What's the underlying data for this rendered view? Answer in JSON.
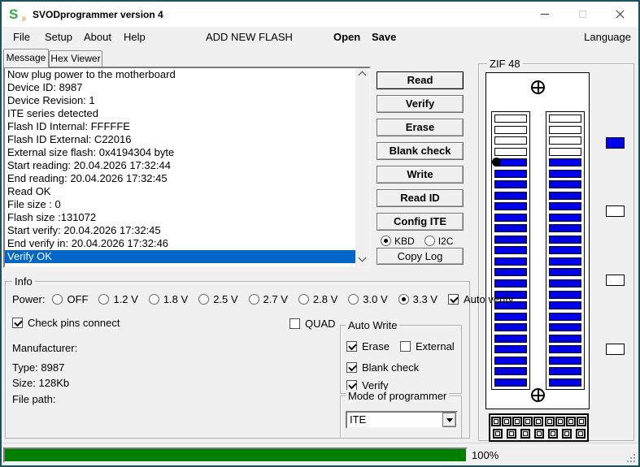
{
  "window": {
    "title": "SVODprogrammer version 4",
    "icon_text": "S",
    "icon_sub": "p"
  },
  "icons": {
    "app": "green-s-logo",
    "minimize": "minus-line",
    "maximize": "square-outline-disabled",
    "close": "x-cross",
    "scroll_up": "chevron-up",
    "scroll_down": "chevron-down",
    "dropdown": "triangle-down",
    "socket_screw": "crosshair-screw",
    "resize_grip": "diagonal-dots"
  },
  "menu": {
    "items": [
      {
        "label": "File"
      },
      {
        "label": "Setup"
      },
      {
        "label": "About"
      },
      {
        "label": "Help"
      },
      {
        "label": "ADD NEW FLASH"
      },
      {
        "label": "Open"
      },
      {
        "label": "Save"
      },
      {
        "label": "Language"
      }
    ]
  },
  "tabs": [
    {
      "label": "Message",
      "selected": true
    },
    {
      "label": "Hex Viewer",
      "selected": false
    }
  ],
  "log": {
    "lines": [
      "Now plug power to the motherboard",
      "Device ID: 8987",
      "Device Revision: 1",
      "ITE series detected",
      "Flash ID Internal: FFFFFE",
      "Flash ID External: C22016",
      "External size flash: 0x4194304 byte",
      "Start reading: 20.04.2026 17:32:44",
      "End reading: 20.04.2026 17:32:45",
      "Read OK",
      "File size : 0",
      "Flash size :131072",
      "Start verify: 20.04.2026 17:32:45",
      "End verify in: 20.04.2026 17:32:46",
      "Verify OK"
    ],
    "selected_index": 14,
    "selection_color": "#0066cc"
  },
  "actions": {
    "buttons": [
      "Read",
      "Verify",
      "Erase",
      "Blank check",
      "Write",
      "Read ID",
      "Config ITE"
    ],
    "interface": [
      {
        "label": "KBD",
        "selected": true
      },
      {
        "label": "I2C",
        "selected": false
      }
    ],
    "copy_log_label": "Copy Log"
  },
  "zif": {
    "title": "ZIF 48",
    "pins_per_column": 25,
    "empty_pins": 4,
    "marker_pin_index": 4,
    "connector_pins": 16,
    "pin_active_color": "#0000f0",
    "side_indicators": [
      "#0000f0",
      "#ffffff",
      "#ffffff",
      "#ffffff"
    ]
  },
  "info": {
    "title": "Info",
    "power_label": "Power:",
    "power_options": [
      {
        "label": "OFF",
        "selected": false
      },
      {
        "label": "1.2 V",
        "selected": false
      },
      {
        "label": "1.8 V",
        "selected": false
      },
      {
        "label": "2.5 V",
        "selected": false
      },
      {
        "label": "2.7 V",
        "selected": false
      },
      {
        "label": "2.8 V",
        "selected": false
      },
      {
        "label": "3.0 V",
        "selected": false
      },
      {
        "label": "3.3 V",
        "selected": true
      }
    ],
    "auto_verify": {
      "label": "Auto verify",
      "checked": true
    },
    "check_pins": {
      "label": "Check pins connect",
      "checked": true
    },
    "quad": {
      "label": "QUAD",
      "checked": false
    },
    "fields": [
      {
        "label": "Manufacturer:",
        "value": ""
      },
      {
        "label": "Type:",
        "value": "8987"
      },
      {
        "label": "Size:",
        "value": "128Kb"
      },
      {
        "label": "File path:",
        "value": ""
      }
    ]
  },
  "auto_write": {
    "title": "Auto Write",
    "options": [
      {
        "label": "Erase",
        "checked": true
      },
      {
        "label": "External",
        "checked": false
      },
      {
        "label": "Blank check",
        "checked": true
      },
      {
        "label": "Verify",
        "checked": true
      }
    ]
  },
  "mode": {
    "title": "Mode of programmer",
    "value": "ITE"
  },
  "status": {
    "progress_value": 100,
    "progress_text": "100%",
    "bar_color": "#008000"
  }
}
